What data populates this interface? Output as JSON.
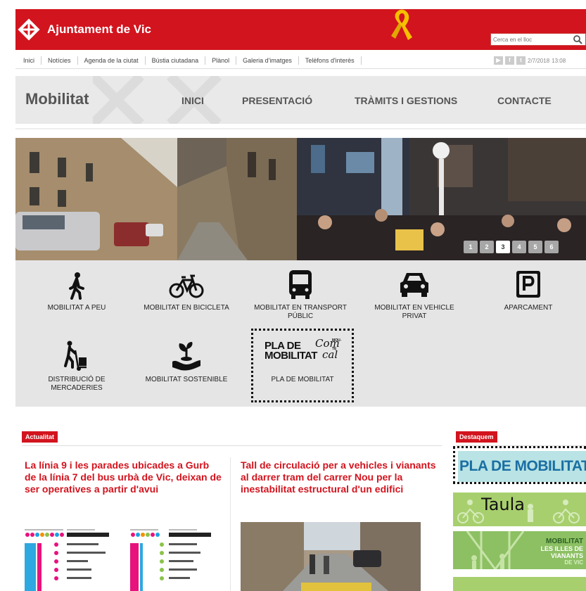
{
  "header": {
    "site_name": "Ajuntament de Vic",
    "search_placeholder": "Cerca en el lloc",
    "date": "2/7/2018",
    "time": "13:08",
    "brand_color": "#d2141e"
  },
  "topnav": [
    "Inici",
    "Notícies",
    "Agenda de la ciutat",
    "Bústia ciutadana",
    "Plànol",
    "Galeria d'imatges",
    "Telèfons d'interès"
  ],
  "social": [
    {
      "icon": "youtube-icon",
      "glyph": "▶"
    },
    {
      "icon": "facebook-icon",
      "glyph": "f"
    },
    {
      "icon": "twitter-icon",
      "glyph": "t"
    }
  ],
  "section": {
    "title": "Mobilitat",
    "nav": [
      "INICI",
      "PRESENTACIÓ",
      "TRÀMITS I GESTIONS",
      "CONTACTE"
    ]
  },
  "slider": {
    "pages": [
      "1",
      "2",
      "3",
      "4",
      "5",
      "6"
    ],
    "active": 3
  },
  "modules": [
    {
      "label": "MOBILITAT A PEU",
      "icon": "walking-person-icon"
    },
    {
      "label": "MOBILITAT EN BICICLETA",
      "icon": "bicycle-icon"
    },
    {
      "label": "MOBILITAT EN TRANSPORT PÚBLIC",
      "icon": "bus-icon"
    },
    {
      "label": "MOBILITAT EN VEHICLE PRIVAT",
      "icon": "car-icon"
    },
    {
      "label": "APARCAMENT",
      "icon": "parking-icon"
    },
    {
      "label": "DISTRIBUCIÓ DE MERCADERIES",
      "icon": "hand-truck-icon"
    },
    {
      "label": "MOBILITAT SOSTENIBLE",
      "icon": "plant-hand-icon"
    },
    {
      "label": "PLA DE MOBILITAT",
      "icon": "pla-mobilitat-logo"
    }
  ],
  "pla_logo": {
    "line1": "PLA DE",
    "line2": "MOBILITAT",
    "script1": "Com",
    "script2": "cal",
    "tag": "MOU-TE"
  },
  "news": {
    "label": "Actualitat",
    "items": [
      {
        "title": "La línia 9 i les parades ubicades a Gurb de la línia 7 del bus urbà de Vic, deixan de ser operatives a partir d'avui"
      },
      {
        "title": "Tall de circulació per a vehicles i vianants al darrer tram del carrer Nou per la inestabilitat estructural d'un edifici"
      }
    ]
  },
  "featured": {
    "label": "Destaquem",
    "banner1": "PLA DE MOBILITAT",
    "banner2": "Taula",
    "banner3_line1": "MOBILITAT",
    "banner3_line2": "LES ILLES DE",
    "banner3_line3": "VIANANTS",
    "banner3_line4": "DE VIC"
  }
}
